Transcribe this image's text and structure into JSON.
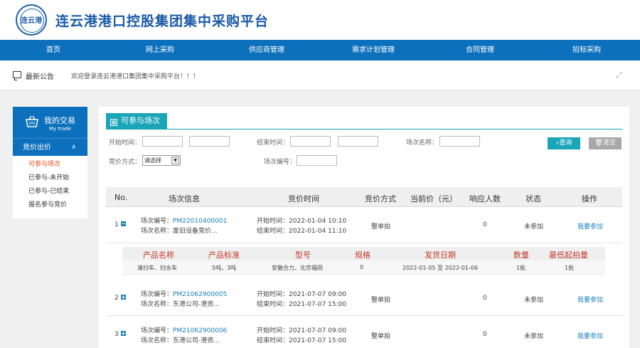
{
  "header": {
    "logo_text": "连云港",
    "title": "连云港港口控股集团集中采购平台"
  },
  "nav": [
    "首页",
    "网上采购",
    "供应商管理",
    "需求计划管理",
    "合同管理",
    "招标采购"
  ],
  "notice": {
    "label": "最新公告",
    "text": "欢迎登录连云港港口集团集中采购平台！！！"
  },
  "sidebar": {
    "title": "我的交易",
    "subtitle": "My trade",
    "section": "竞价出价",
    "links": [
      "可参与场次",
      "已参与-未开始",
      "已参与-已结束",
      "报名参与竞价"
    ]
  },
  "main": {
    "tab": "可参与场次",
    "filters": {
      "start_time": "开始时间：",
      "end_time": "结束时间：",
      "session_name": "场次名称：",
      "method": "竞价方式：",
      "method_value": "请选择",
      "session_no": "场次编号：",
      "search": "查询",
      "clear": "清空"
    },
    "columns": [
      "No.",
      "场次信息",
      "竞价时间",
      "竞价方式",
      "当前价（元）",
      "响应人数",
      "状态",
      "操作"
    ],
    "rows": [
      {
        "no": "1",
        "code_label": "场次编号：",
        "code": "PM22010400001",
        "name_label": "场次名称：",
        "name": "废旧设备竞价...",
        "start_label": "开始时间：",
        "start": "2022-01-04 10:10",
        "end_label": "结束时间：",
        "end": "2022-01-04 11:10",
        "method": "整单拍",
        "price": "",
        "responses": "0",
        "status": "未参加",
        "action": "我要参加",
        "expanded": true
      },
      {
        "no": "2",
        "code_label": "场次编号：",
        "code": "PM21062900005",
        "name_label": "场次名称：",
        "name": "东港公司-港资...",
        "start_label": "开始时间：",
        "start": "2021-07-07 09:00",
        "end_label": "结束时间：",
        "end": "2021-07-07 15:00",
        "method": "整单拍",
        "price": "",
        "responses": "0",
        "status": "未参加",
        "action": "我要参加",
        "expanded": false
      },
      {
        "no": "3",
        "code_label": "场次编号：",
        "code": "PM21062900006",
        "name_label": "场次名称：",
        "name": "东港公司-港资...",
        "start_label": "开始时间：",
        "start": "2021-07-07 09:00",
        "end_label": "结束时间：",
        "end": "2021-07-07 15:00",
        "method": "整单拍",
        "price": "",
        "responses": "0",
        "status": "未参加",
        "action": "我要参加",
        "expanded": false
      }
    ],
    "detail": {
      "columns": [
        "产品名称",
        "产品标准",
        "型号",
        "规格",
        "发货日期",
        "数量",
        "最低起拍量"
      ],
      "row": {
        "name": "清扫车、扫水车",
        "standard": "5吨，3吨",
        "model": "安徽合力、北京福田",
        "spec": "0",
        "date": "2022-01-05 至 2022-01-06",
        "qty": "1批",
        "min": "1批"
      }
    }
  }
}
